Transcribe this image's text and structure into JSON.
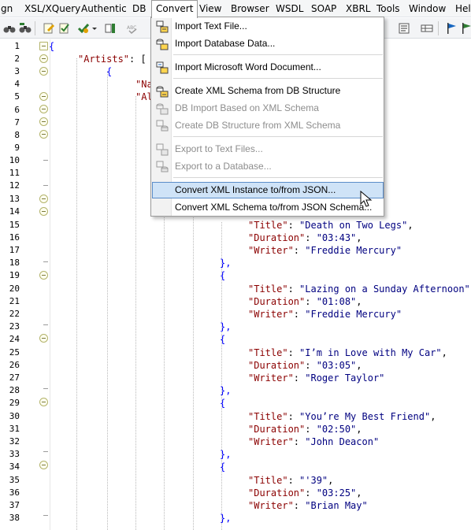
{
  "menubar": {
    "items": [
      {
        "label": "gn"
      },
      {
        "label": "XSL/XQuery"
      },
      {
        "label": "Authentic"
      },
      {
        "label": "DB"
      },
      {
        "label": "Convert"
      },
      {
        "label": "View"
      },
      {
        "label": "Browser"
      },
      {
        "label": "WSDL"
      },
      {
        "label": "SOAP"
      },
      {
        "label": "XBRL"
      },
      {
        "label": "Tools"
      },
      {
        "label": "Window"
      },
      {
        "label": "Help"
      }
    ]
  },
  "convert_menu": {
    "items": [
      {
        "label": "Import Text File...",
        "icon": "import-text-icon",
        "enabled": true
      },
      {
        "label": "Import Database Data...",
        "icon": "import-database-icon",
        "enabled": true
      },
      {
        "label": "Import Microsoft Word Document...",
        "icon": "import-word-icon",
        "enabled": true
      },
      {
        "label": "Create XML Schema from DB Structure",
        "icon": "create-schema-icon",
        "enabled": true
      },
      {
        "label": "DB Import Based on XML Schema",
        "icon": "db-import-icon",
        "enabled": false
      },
      {
        "label": "Create DB Structure from XML Schema",
        "icon": "create-db-structure-icon",
        "enabled": false
      },
      {
        "label": "Export to Text Files...",
        "icon": "export-text-icon",
        "enabled": false
      },
      {
        "label": "Export to a Database...",
        "icon": "export-database-icon",
        "enabled": false
      },
      {
        "label": "Convert XML Instance to/from JSON...",
        "icon": "",
        "enabled": true,
        "highlighted": true
      },
      {
        "label": "Convert XML Schema to/from JSON Schema...",
        "icon": "",
        "enabled": true
      }
    ]
  },
  "editor": {
    "line_numbers": [
      "1",
      "2",
      "3",
      "4",
      "5",
      "6",
      "7",
      "8",
      "9",
      "10",
      "11",
      "12",
      "13",
      "14",
      "15",
      "16",
      "17",
      "18",
      "19",
      "20",
      "21",
      "22",
      "23",
      "24",
      "25",
      "26",
      "27",
      "28",
      "29",
      "30",
      "31",
      "32",
      "33",
      "34",
      "35",
      "36",
      "37",
      "38"
    ],
    "lines": {
      "l1_brace": "{",
      "l2_key": "\"Artists\"",
      "l2_rest": ": [",
      "l3_brace": "{",
      "l4_frag": "\"Na",
      "l5_frag": "\"Al",
      "tracks": [
        {
          "title": "\"Death on Two Legs\"",
          "duration": "\"03:43\"",
          "writer": "\"Freddie Mercury\""
        },
        {
          "title": "\"Lazing on a Sunday Afternoon\"",
          "duration": "\"01:08\"",
          "writer": "\"Freddie Mercury\""
        },
        {
          "title": "\"I’m in Love with My Car\"",
          "duration": "\"03:05\"",
          "writer": "\"Roger Taylor\""
        },
        {
          "title": "\"You’re My Best Friend\"",
          "duration": "\"02:50\"",
          "writer": "\"John Deacon\""
        },
        {
          "title": "\"'39\"",
          "duration": "\"03:25\"",
          "writer": "\"Brian May\""
        }
      ],
      "title_key": "\"Title\"",
      "duration_key": "\"Duration\"",
      "writer_key": "\"Writer\"",
      "close_brace": "},",
      "open_brace": "{"
    }
  },
  "colors": {
    "json_key": "#8b0000",
    "json_string": "#000080",
    "brace": "#0000ff",
    "menu_highlight": "#cfe3f7",
    "menu_highlight_border": "#5a8cc8"
  }
}
